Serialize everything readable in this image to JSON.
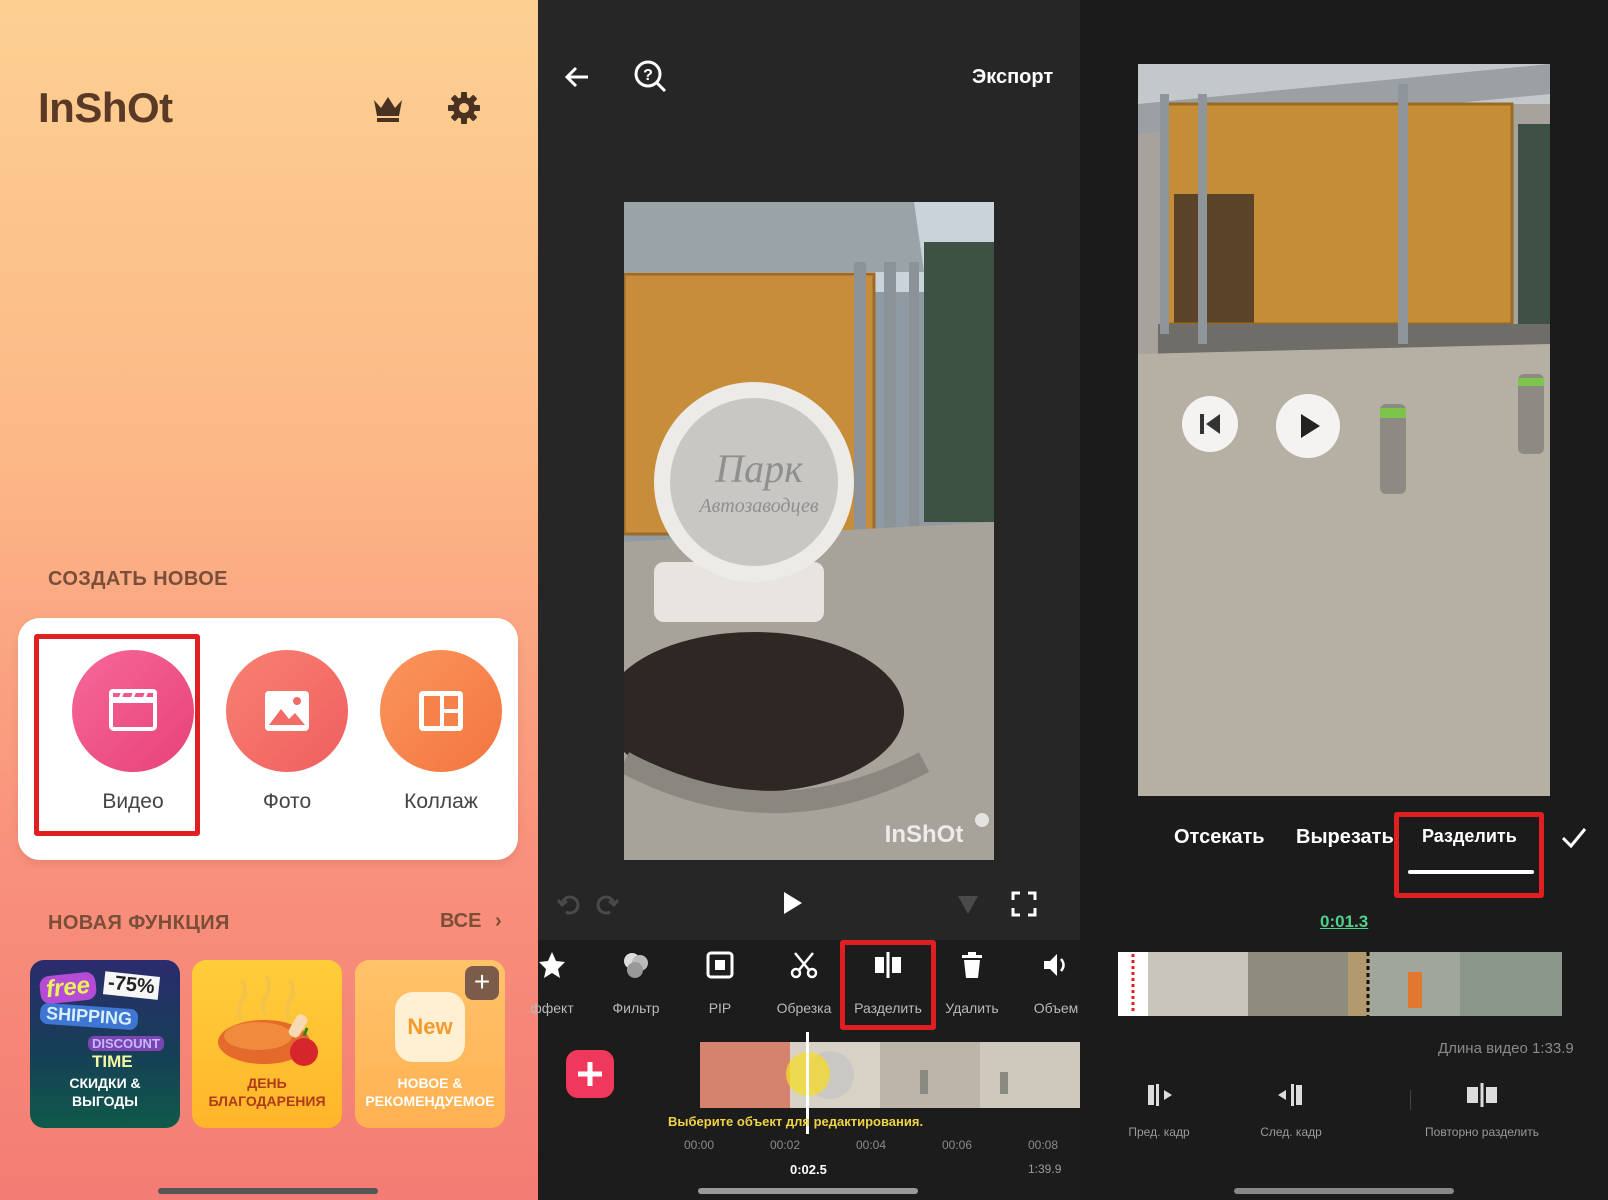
{
  "home": {
    "logo": "InShOt",
    "create_section_title": "СОЗДАТЬ НОВОЕ",
    "create_items": [
      {
        "label": "Видео",
        "icon": "clapperboard-icon"
      },
      {
        "label": "Фото",
        "icon": "image-icon"
      },
      {
        "label": "Коллаж",
        "icon": "collage-icon"
      }
    ],
    "feature_section_title": "НОВАЯ ФУНКЦИЯ",
    "all_link": "ВСЕ",
    "feature_cards": [
      {
        "badge_free": "free",
        "badge_discount": "-75%",
        "badge_shipping": "SHIPPING",
        "badge_discount_label": "DISCOUNT",
        "badge_time": "TIME",
        "caption_line1": "СКИДКИ &",
        "caption_line2": "ВЫГОДЫ"
      },
      {
        "caption_line1": "ДЕНЬ",
        "caption_line2": "БЛАГОДАРЕНИЯ"
      },
      {
        "badge_new": "New",
        "caption_line1": "НОВОЕ &",
        "caption_line2": "РЕКОМЕНДУЕМОЕ"
      }
    ],
    "colors": {
      "accent_red": "#e02020",
      "video": "#ee4f86",
      "photo": "#f26b66",
      "collage": "#f5824a"
    }
  },
  "editor": {
    "export_label": "Экспорт",
    "preview_sign_line1": "Парк",
    "preview_sign_line2": "Автозаводцев",
    "watermark": "InShOt",
    "tools": [
      {
        "label": "ффект",
        "icon": "star-icon"
      },
      {
        "label": "Фильтр",
        "icon": "filter-icon"
      },
      {
        "label": "PIP",
        "icon": "pip-icon"
      },
      {
        "label": "Обрезка",
        "icon": "scissors-icon"
      },
      {
        "label": "Разделить",
        "icon": "split-icon"
      },
      {
        "label": "Удалить",
        "icon": "trash-icon"
      },
      {
        "label": "Объем",
        "icon": "volume-icon"
      }
    ],
    "hint": "Выберите объект для редактирования.",
    "ruler": [
      "00:00",
      "00:02",
      "00:04",
      "00:06",
      "00:08"
    ],
    "current_time": "0:02.5",
    "total_time": "1:39.9"
  },
  "split": {
    "tabs": [
      "Отсекать",
      "Вырезать",
      "Разделить"
    ],
    "active_tab": "Разделить",
    "split_time": "0:01.3",
    "video_length": "Длина видео 1:33.9",
    "tools": [
      {
        "label": "Пред. кадр",
        "icon": "prev-frame-icon"
      },
      {
        "label": "След. кадр",
        "icon": "next-frame-icon"
      },
      {
        "label": "Повторно разделить",
        "icon": "resplit-icon"
      }
    ]
  }
}
